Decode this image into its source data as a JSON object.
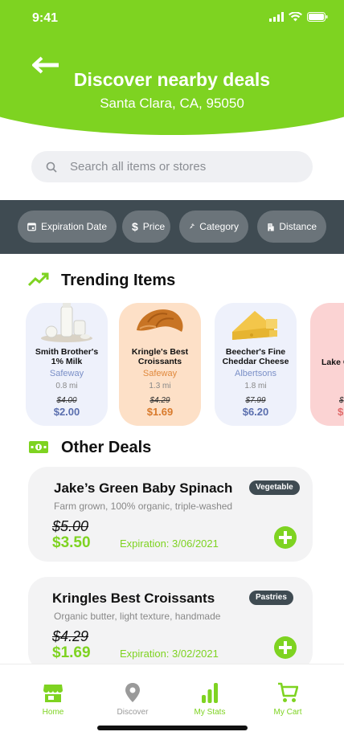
{
  "status_bar": {
    "time": "9:41"
  },
  "header": {
    "title": "Discover nearby deals",
    "location": "Santa Clara, CA, 95050"
  },
  "search": {
    "placeholder": "Search all items or stores"
  },
  "filters": [
    {
      "label": "Expiration Date",
      "icon": "calendar-icon"
    },
    {
      "label": "Price",
      "icon": "dollar-icon"
    },
    {
      "label": "Category",
      "icon": "carrot-icon"
    },
    {
      "label": "Distance",
      "icon": "building-icon"
    }
  ],
  "trending": {
    "title": "Trending Items",
    "icon": "trending-up-icon",
    "items": [
      {
        "name": "Smith Brother's 1% Milk",
        "store": "Safeway",
        "distance": "0.8 mi",
        "old_price": "$4.00",
        "new_price": "$2.00",
        "bg": "#eef1fb",
        "accent": "#7a8fc7",
        "price_color": "#5b6fae"
      },
      {
        "name": "Kringle's Best Croissants",
        "store": "Safeway",
        "distance": "1.3 mi",
        "old_price": "$4.29",
        "new_price": "$1.69",
        "bg": "#fde0c7",
        "accent": "#e0893d",
        "price_color": "#d87a2c"
      },
      {
        "name": "Beecher's Fine Cheddar Cheese",
        "store": "Albertsons",
        "distance": "1.8 mi",
        "old_price": "$7.99",
        "new_price": "$6.20",
        "bg": "#eef1fb",
        "accent": "#7a8fc7",
        "price_color": "#5b6fae"
      },
      {
        "name": "Lake Organ",
        "store": "",
        "distance": "",
        "old_price": "$",
        "new_price": "$",
        "bg": "#fbd3d3",
        "accent": "#e06b6b",
        "price_color": "#e06b6b"
      }
    ]
  },
  "other_deals": {
    "title": "Other Deals",
    "icon": "cash-icon",
    "items": [
      {
        "name": "Jake’s Green Baby Spinach",
        "tag": "Vegetable",
        "description": "Farm grown, 100% organic, triple-washed",
        "old_price": "$5.00",
        "new_price": "$3.50",
        "expiration": "Expiration: 3/06/2021"
      },
      {
        "name": "Kringles Best Croissants",
        "tag": "Pastries",
        "description": "Organic butter, light texture, handmade",
        "old_price": "$4.29",
        "new_price": "$1.69",
        "expiration": "Expiration: 3/02/2021"
      }
    ]
  },
  "tabs": [
    {
      "label": "Home",
      "icon": "store-icon",
      "active": true
    },
    {
      "label": "Discover",
      "icon": "map-pin-icon",
      "active": false
    },
    {
      "label": "My Stats",
      "icon": "bar-chart-icon",
      "active": true
    },
    {
      "label": "My Cart",
      "icon": "cart-icon",
      "active": true
    }
  ],
  "colors": {
    "brand": "#7ED321",
    "dark": "#3f4b52",
    "inactive": "#9a9a9a"
  }
}
